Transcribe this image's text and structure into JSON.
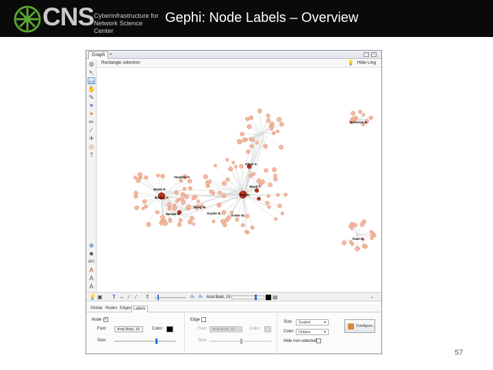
{
  "header": {
    "logo_text": "CNS",
    "logo_subtitle_line1": "Cyberinfrastructure for",
    "logo_subtitle_line2": "Network Science Center",
    "title": "Gephi: Node Labels – Overview"
  },
  "graph_window": {
    "tab_label": "Graph",
    "selection_mode": "Rectangle selection",
    "hint_label": "Hide Ling",
    "node_labels": [
      "Oliver Z.",
      "Vaughan A",
      "Walsh R.",
      "Ravi R.",
      "Brnd L. A",
      "Mendel H",
      "Snyder B.",
      "Wood T.",
      "Sloog W.",
      "Ketter W.",
      "Nammion B.",
      "Kaan B."
    ],
    "bottom_toolbar": {
      "font_label": "Arial Bold, 15"
    }
  },
  "properties": {
    "tabs": [
      "Global",
      "Nodes",
      "Edges",
      "Labels"
    ],
    "active_tab": "Labels",
    "node_section": {
      "label": "Node",
      "checked": true,
      "font_label": "Font:",
      "font_value": "Arial Bold, 16",
      "color_label": "Color:",
      "color": "#000000",
      "size_label": "Size:"
    },
    "edge_section": {
      "label": "Edge",
      "checked": false,
      "font_label": "Font:",
      "font_value": "Arial Bold, 32",
      "color_label": "Color:",
      "color": "#bbbbbb",
      "size_label": "Size:"
    },
    "options_section": {
      "size_label": "Size:",
      "size_value": "Scaled",
      "color_label": "Color:",
      "color_value": "Unique",
      "hide_label": "Hide non-selected",
      "hide_checked": false
    },
    "configure_button": "Configure..."
  },
  "page_number": "57",
  "colors": {
    "node_fill": "#f3b8a0",
    "node_stroke": "#d47a5c",
    "hub_fill": "#b7321f",
    "edge": "#c8c8c8"
  }
}
